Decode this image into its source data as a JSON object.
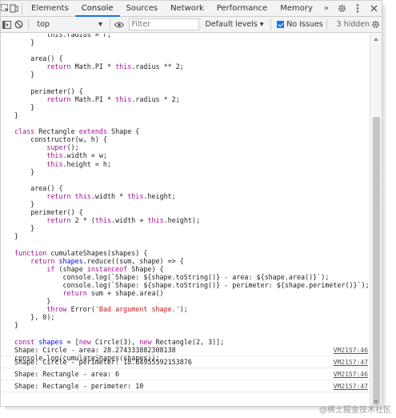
{
  "tabs": {
    "items": [
      {
        "label": "Elements"
      },
      {
        "label": "Console"
      },
      {
        "label": "Sources"
      },
      {
        "label": "Network"
      },
      {
        "label": "Performance"
      },
      {
        "label": "Memory"
      }
    ],
    "more": "»",
    "active": "Console"
  },
  "toolbar": {
    "context": "top",
    "filter_placeholder": "Filter",
    "levels": "Default levels ▾",
    "no_issues": "No Issues",
    "hidden": "3 hidden"
  },
  "code_lines": [
    [
      [
        "        this.radius = r;",
        ""
      ]
    ],
    [
      [
        "    }",
        ""
      ]
    ],
    [
      [
        "",
        ""
      ]
    ],
    [
      [
        "    area() {",
        ""
      ]
    ],
    [
      [
        "        ",
        ""
      ],
      [
        "return",
        "k"
      ],
      [
        " Math.PI * ",
        ""
      ],
      [
        "this",
        "k"
      ],
      [
        ".radius ** 2;",
        ""
      ]
    ],
    [
      [
        "    }",
        ""
      ]
    ],
    [
      [
        "",
        ""
      ]
    ],
    [
      [
        "    perimeter() {",
        ""
      ]
    ],
    [
      [
        "        ",
        ""
      ],
      [
        "return",
        "k"
      ],
      [
        " Math.PI * ",
        ""
      ],
      [
        "this",
        "k"
      ],
      [
        ".radius * 2;",
        ""
      ]
    ],
    [
      [
        "    }",
        ""
      ]
    ],
    [
      [
        "}",
        ""
      ]
    ],
    [
      [
        "",
        ""
      ]
    ],
    [
      [
        "class",
        "k"
      ],
      [
        " Rectangle ",
        ""
      ],
      [
        "extends",
        "k"
      ],
      [
        " Shape {",
        ""
      ]
    ],
    [
      [
        "    constructor(w, h) {",
        ""
      ]
    ],
    [
      [
        "        ",
        ""
      ],
      [
        "super",
        "k"
      ],
      [
        "();",
        ""
      ]
    ],
    [
      [
        "        ",
        ""
      ],
      [
        "this",
        "k"
      ],
      [
        ".width = w;",
        ""
      ]
    ],
    [
      [
        "        ",
        ""
      ],
      [
        "this",
        "k"
      ],
      [
        ".height = h;",
        ""
      ]
    ],
    [
      [
        "    }",
        ""
      ]
    ],
    [
      [
        "",
        ""
      ]
    ],
    [
      [
        "    area() {",
        ""
      ]
    ],
    [
      [
        "        ",
        ""
      ],
      [
        "return",
        "k"
      ],
      [
        " ",
        ""
      ],
      [
        "this",
        "k"
      ],
      [
        ".width * ",
        ""
      ],
      [
        "this",
        "k"
      ],
      [
        ".height;",
        ""
      ]
    ],
    [
      [
        "    }",
        ""
      ]
    ],
    [
      [
        "    perimeter() {",
        ""
      ]
    ],
    [
      [
        "        ",
        ""
      ],
      [
        "return",
        "k"
      ],
      [
        " 2 * (",
        ""
      ],
      [
        "this",
        "k"
      ],
      [
        ".width + ",
        ""
      ],
      [
        "this",
        "k"
      ],
      [
        ".height);",
        ""
      ]
    ],
    [
      [
        "    }",
        ""
      ]
    ],
    [
      [
        "}",
        ""
      ]
    ],
    [
      [
        "",
        ""
      ]
    ],
    [
      [
        "function",
        "k"
      ],
      [
        " cumulateShapes(shapes) {",
        ""
      ]
    ],
    [
      [
        "    ",
        ""
      ],
      [
        "return",
        "k"
      ],
      [
        " ",
        ""
      ],
      [
        "shapes",
        "v"
      ],
      [
        ".reduce((sum, shape) => {",
        ""
      ]
    ],
    [
      [
        "        ",
        ""
      ],
      [
        "if",
        "k"
      ],
      [
        " (shape ",
        ""
      ],
      [
        "instanceof",
        "k"
      ],
      [
        " Shape) {",
        ""
      ]
    ],
    [
      [
        "            console.log(`Shape: ${shape.toString()} - area: ${shape.area()}`);",
        ""
      ]
    ],
    [
      [
        "            console.log(`Shape: ${shape.toString()} - perimeter: ${shape.perimeter()}`);",
        ""
      ]
    ],
    [
      [
        "            ",
        ""
      ],
      [
        "return",
        "k"
      ],
      [
        " sum + shape.area()",
        ""
      ]
    ],
    [
      [
        "        }",
        ""
      ]
    ],
    [
      [
        "        ",
        ""
      ],
      [
        "throw",
        "k"
      ],
      [
        " Error(",
        ""
      ],
      [
        "'Bad argument shape.'",
        "s"
      ],
      [
        ");",
        ""
      ]
    ],
    [
      [
        "    }, 0);",
        ""
      ]
    ],
    [
      [
        "}",
        ""
      ]
    ],
    [
      [
        "",
        ""
      ]
    ],
    [
      [
        "const",
        "k"
      ],
      [
        " ",
        ""
      ],
      [
        "shapes",
        "v"
      ],
      [
        " = [",
        ""
      ],
      [
        "new",
        "k"
      ],
      [
        " Circle(3), ",
        ""
      ],
      [
        "new",
        "k"
      ],
      [
        " Rectangle(2, 3)];",
        ""
      ]
    ],
    [
      [
        "",
        ""
      ]
    ],
    [
      [
        "console.log(cumulateShapes(shapes));",
        ""
      ]
    ]
  ],
  "logs": [
    {
      "text": "Shape: Circle - area: 28.274333882308138",
      "source": "VM2157:46"
    },
    {
      "text": "Shape: Circle - perimeter: 18.84955592153876",
      "source": "VM2157:47"
    },
    {
      "text": "Shape: Rectangle - area: 6",
      "source": "VM2157:46"
    },
    {
      "text": "Shape: Rectangle - perimeter: 10",
      "source": "VM2157:47"
    }
  ],
  "watermark": "@稀土掘金技术社区",
  "colors": {
    "keyword": "#aa0d91",
    "string": "#c41a16",
    "variable": "#0000ff",
    "active_tab": "#1a73e8"
  },
  "icons": [
    "inspect-icon",
    "device-toggle-icon",
    "sidebar-icon",
    "clear-console-icon",
    "eye-icon",
    "settings-icon",
    "more-icon",
    "close-icon"
  ]
}
